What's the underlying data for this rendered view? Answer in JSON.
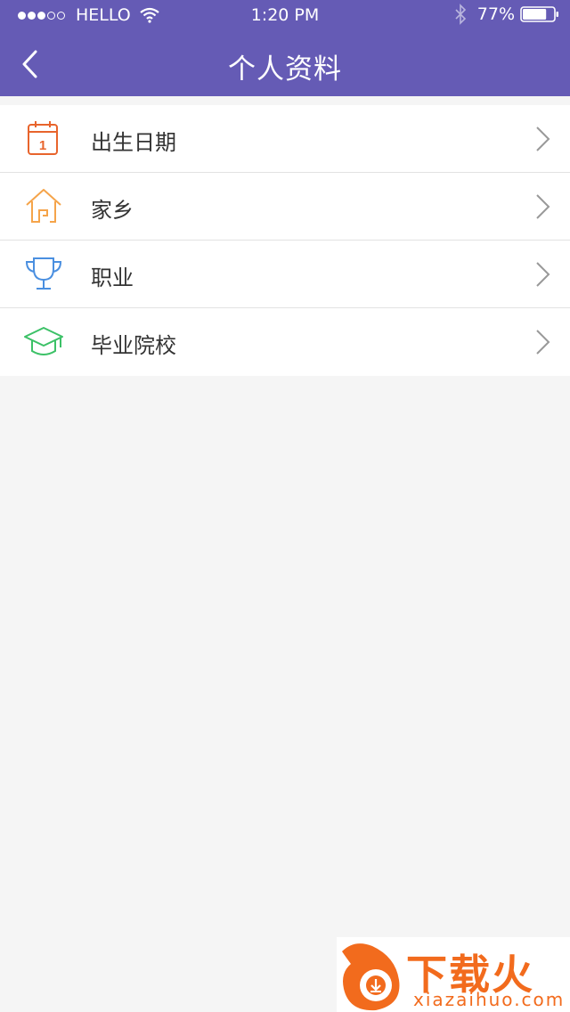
{
  "status_bar": {
    "carrier": "HELLO",
    "time": "1:20 PM",
    "battery_percent": "77%",
    "battery_level": 0.77
  },
  "nav": {
    "title": "个人资料"
  },
  "list": {
    "items": [
      {
        "label": "出生日期",
        "icon": "calendar-icon",
        "color": "#e8642c",
        "day": "1"
      },
      {
        "label": "家乡",
        "icon": "house-icon",
        "color": "#f5a44a"
      },
      {
        "label": "职业",
        "icon": "trophy-icon",
        "color": "#4a8fe0"
      },
      {
        "label": "毕业院校",
        "icon": "graduation-cap-icon",
        "color": "#3cc167"
      }
    ]
  },
  "watermark": {
    "title": "下载火",
    "url": "xiazaihuo.com"
  },
  "colors": {
    "header": "#655bb5",
    "background": "#f5f5f5",
    "chevron": "#999999",
    "watermark": "#f26b1d"
  }
}
